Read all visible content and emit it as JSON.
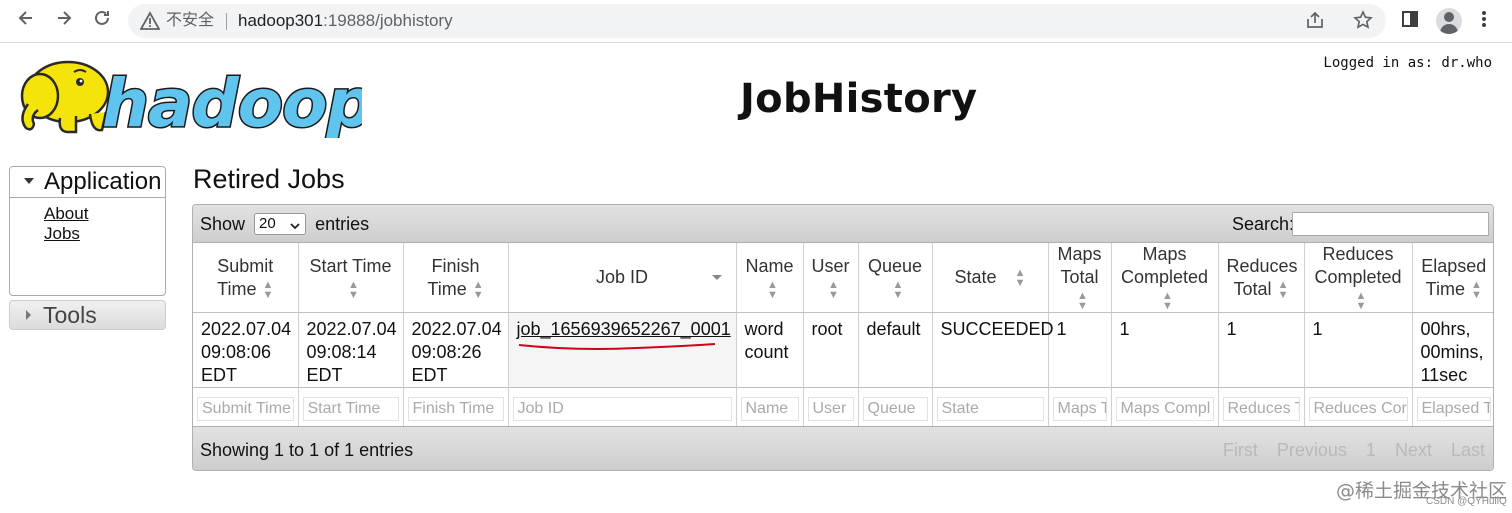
{
  "browser": {
    "security_label": "不安全",
    "url_host": "hadoop301",
    "url_rest": ":19888/jobhistory"
  },
  "header": {
    "logo_text": "hadoop",
    "title": "JobHistory",
    "logged_in": "Logged in as: dr.who"
  },
  "sidebar": {
    "application_label": "Application",
    "links": [
      "About",
      "Jobs"
    ],
    "tools_label": "Tools"
  },
  "main": {
    "section_title": "Retired Jobs",
    "show_label": "Show",
    "entries_value": "20",
    "entries_label": "entries",
    "search_label": "Search:",
    "columns": [
      {
        "line1": "Submit",
        "line2": "Time"
      },
      {
        "line1": "Start Time",
        "line2": ""
      },
      {
        "line1": "Finish",
        "line2": "Time"
      },
      {
        "line1": "Job ID",
        "line2": ""
      },
      {
        "line1": "Name",
        "line2": ""
      },
      {
        "line1": "User",
        "line2": ""
      },
      {
        "line1": "Queue",
        "line2": ""
      },
      {
        "line1": "State",
        "line2": ""
      },
      {
        "line1": "Maps",
        "line2": "Total"
      },
      {
        "line1": "Maps",
        "line2": "Completed"
      },
      {
        "line1": "Reduces",
        "line2": "Total"
      },
      {
        "line1": "Reduces",
        "line2": "Completed"
      },
      {
        "line1": "Elapsed",
        "line2": "Time"
      }
    ],
    "row": {
      "submit": [
        "2022.07.04",
        "09:08:06",
        "EDT"
      ],
      "start": [
        "2022.07.04",
        "09:08:14",
        "EDT"
      ],
      "finish": [
        "2022.07.04",
        "09:08:26",
        "EDT"
      ],
      "job_id": "job_1656939652267_0001",
      "name": [
        "word",
        "count"
      ],
      "user": "root",
      "queue": "default",
      "state": "SUCCEEDED",
      "maps_total": "1",
      "maps_completed": "1",
      "reduces_total": "1",
      "reduces_completed": "1",
      "elapsed": [
        "00hrs,",
        "00mins,",
        "11sec"
      ]
    },
    "filters": [
      "Submit Time",
      "Start Time",
      "Finish Time",
      "Job ID",
      "Name",
      "User",
      "Queue",
      "State",
      "Maps T",
      "Maps Compl",
      "Reduces T",
      "Reduces Cor",
      "Elapsed T"
    ],
    "showing": "Showing 1 to 1 of 1 entries",
    "pager": {
      "first": "First",
      "previous": "Previous",
      "page": "1",
      "next": "Next",
      "last": "Last"
    }
  },
  "watermark": {
    "main": "@稀土掘金技术社区",
    "sub": "CSDN @QYHuiiQ"
  },
  "colors": {
    "annotation": "#d0021b",
    "logo_blue": "#5fc4ee",
    "logo_yellow": "#f5e40a"
  }
}
